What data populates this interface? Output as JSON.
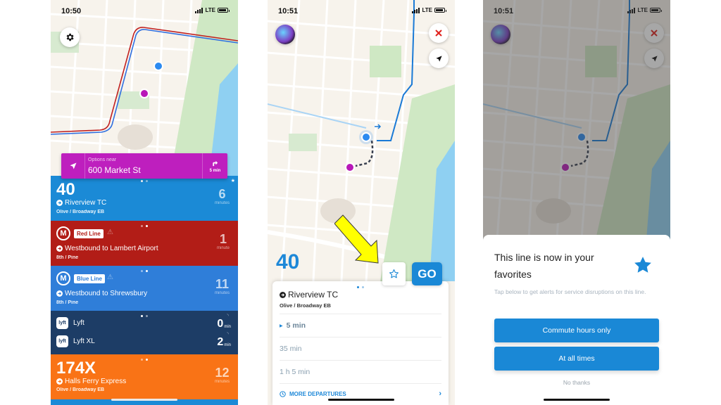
{
  "screen1": {
    "status": {
      "time": "10:50",
      "network": "LTE"
    },
    "search": {
      "label": "Options near",
      "address": "600 Market St",
      "walk_time": "5 min"
    },
    "cards": [
      {
        "type": "bus",
        "route": "40",
        "destination": "Riverview TC",
        "stop": "Olive / Broadway EB",
        "eta": "6",
        "unit": "minutes",
        "color": "#1b8ad6",
        "favorite": true
      },
      {
        "type": "metro",
        "line": "Red Line",
        "destination": "Westbound to Lambert Airport",
        "stop": "8th / Pine",
        "eta": "1",
        "unit": "minute",
        "color": "#b21d17",
        "alert": true
      },
      {
        "type": "metro",
        "line": "Blue Line",
        "destination": "Westbound to Shrewsbury",
        "stop": "8th / Pine",
        "eta": "11",
        "unit": "minutes",
        "color": "#2f7ed9",
        "alert": true
      },
      {
        "type": "rideshare",
        "color": "#1d3d66",
        "options": [
          {
            "name": "Lyft",
            "eta": "0",
            "unit": "min"
          },
          {
            "name": "Lyft XL",
            "eta": "2",
            "unit": "min"
          }
        ]
      },
      {
        "type": "bus",
        "route": "174X",
        "destination": "Halls Ferry Express",
        "stop": "Olive / Broadway EB",
        "eta": "12",
        "unit": "minutes",
        "color": "#f97316"
      }
    ]
  },
  "screen2": {
    "status": {
      "time": "10:51",
      "network": "LTE"
    },
    "route": "40",
    "go_label": "GO",
    "destination": "Riverview TC",
    "stop": "Olive / Broadway EB",
    "departures": [
      "5 min",
      "35 min",
      "1 h 5 min"
    ],
    "more_label": "MORE DEPARTURES"
  },
  "screen3": {
    "status": {
      "time": "10:51",
      "network": "LTE"
    },
    "modal": {
      "title": "This line is now in your favorites",
      "subtitle": "Tap below to get alerts for service disruptions on this line.",
      "buttons": [
        "Commute hours only",
        "At all times"
      ],
      "dismiss": "No thanks"
    }
  },
  "colors": {
    "accent": "#1a88d6",
    "search_bar": "#be1fbe",
    "highlight_arrow": "#ffff00"
  }
}
